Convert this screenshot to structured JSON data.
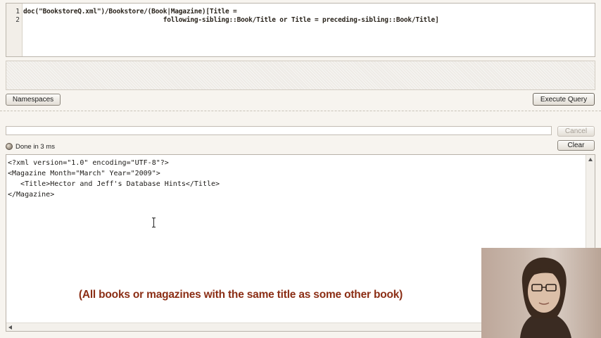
{
  "editor": {
    "line_numbers": [
      "1",
      "2"
    ],
    "lines": [
      "doc(\"BookstoreQ.xml\")/Bookstore/(Book|Magazine)[Title =",
      "                                    following-sibling::Book/Title or Title = preceding-sibling::Book/Title]"
    ]
  },
  "toolbar": {
    "namespaces_label": "Namespaces",
    "execute_label": "Execute Query"
  },
  "progress": {
    "cancel_label": "Cancel"
  },
  "status": {
    "text": "Done in 3 ms",
    "clear_label": "Clear"
  },
  "results": {
    "lines": [
      "<?xml version=\"1.0\" encoding=\"UTF-8\"?>",
      "<Magazine Month=\"March\" Year=\"2009\">",
      "   <Title>Hector and Jeff's Database Hints</Title>",
      "</Magazine>"
    ]
  },
  "caption": "(All books or magazines with the same title as some other book)",
  "icons": {
    "status": "status-indicator-icon",
    "cursor": "text-cursor-icon"
  },
  "colors": {
    "caption": "#8b2e15",
    "background": "#f7f4ef"
  }
}
